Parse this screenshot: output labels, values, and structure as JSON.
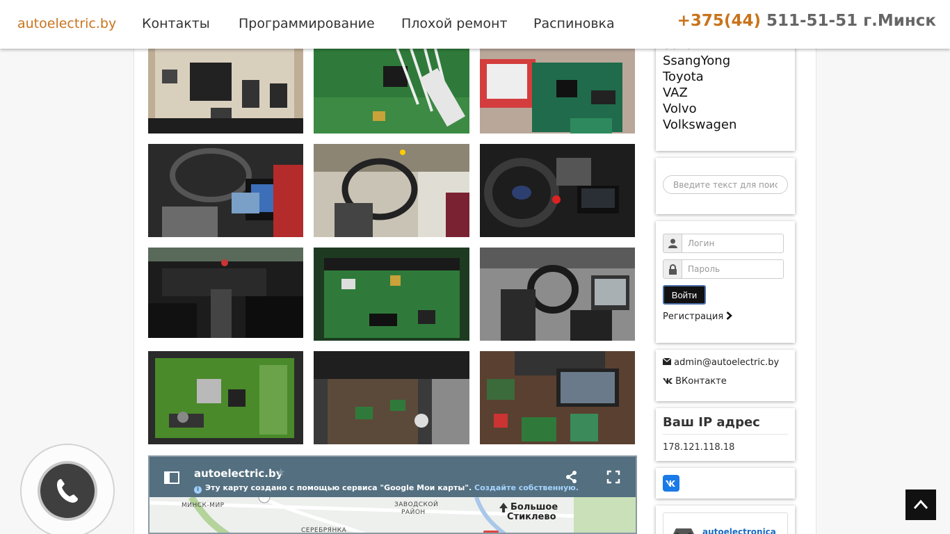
{
  "header": {
    "brand": "autoelectric.by",
    "nav": [
      "Контакты",
      "Программирование",
      "Плохой ремонт",
      "Распиновка"
    ],
    "phone_code": "+375(44)",
    "phone_rest": " 511-51-51 г.Минск",
    "accent_color": "#c8741c"
  },
  "gallery": {
    "photos": [
      "ecu-board-closeup",
      "green-pcb-wired",
      "bosch-ecu-open",
      "car-interior-laptop",
      "car-interior-beige",
      "car-interior-laptop-dark",
      "car-interior-dashboard",
      "green-pcb-large",
      "car-interior-tablet",
      "green-ecu-board",
      "car-floor-modules",
      "workbench-laptop-pcb"
    ]
  },
  "map": {
    "title": "autoelectric.by",
    "note": "Эту карту создано с помощью сервиса \"Google Мои карты\".",
    "note_link": "Создайте собственную.",
    "labels": [
      "МИНСК-МИР",
      "ЗАВОДСКОЙ",
      "РАЙОН",
      "СЕРЕБРЯНКА"
    ],
    "city_label_1": "Большое",
    "city_label_2": "Стиклево"
  },
  "sidebar": {
    "brands": [
      "Suzuki",
      "SsangYong",
      "Toyota",
      "VAZ",
      "Volvo",
      "Volkswagen"
    ],
    "search_placeholder": "Введите текст для поиска...",
    "login_placeholder": "Логин",
    "password_placeholder": "Пароль",
    "login_button": "Войти",
    "register_link": "Регистрация",
    "email": "admin@autoelectric.by",
    "vk": "ВКонтакте",
    "ip_title": "Ваш IP адрес",
    "ip_value": "178.121.118.18",
    "partner_text": "autoelectronica"
  },
  "icons": {
    "phone_call": "phone-icon",
    "scroll_top": "chevron-up-icon",
    "user": "user-icon",
    "lock": "lock-icon",
    "envelope": "envelope-icon",
    "vk": "vk-icon",
    "share": "share-icon",
    "fullscreen": "fullscreen-icon"
  }
}
